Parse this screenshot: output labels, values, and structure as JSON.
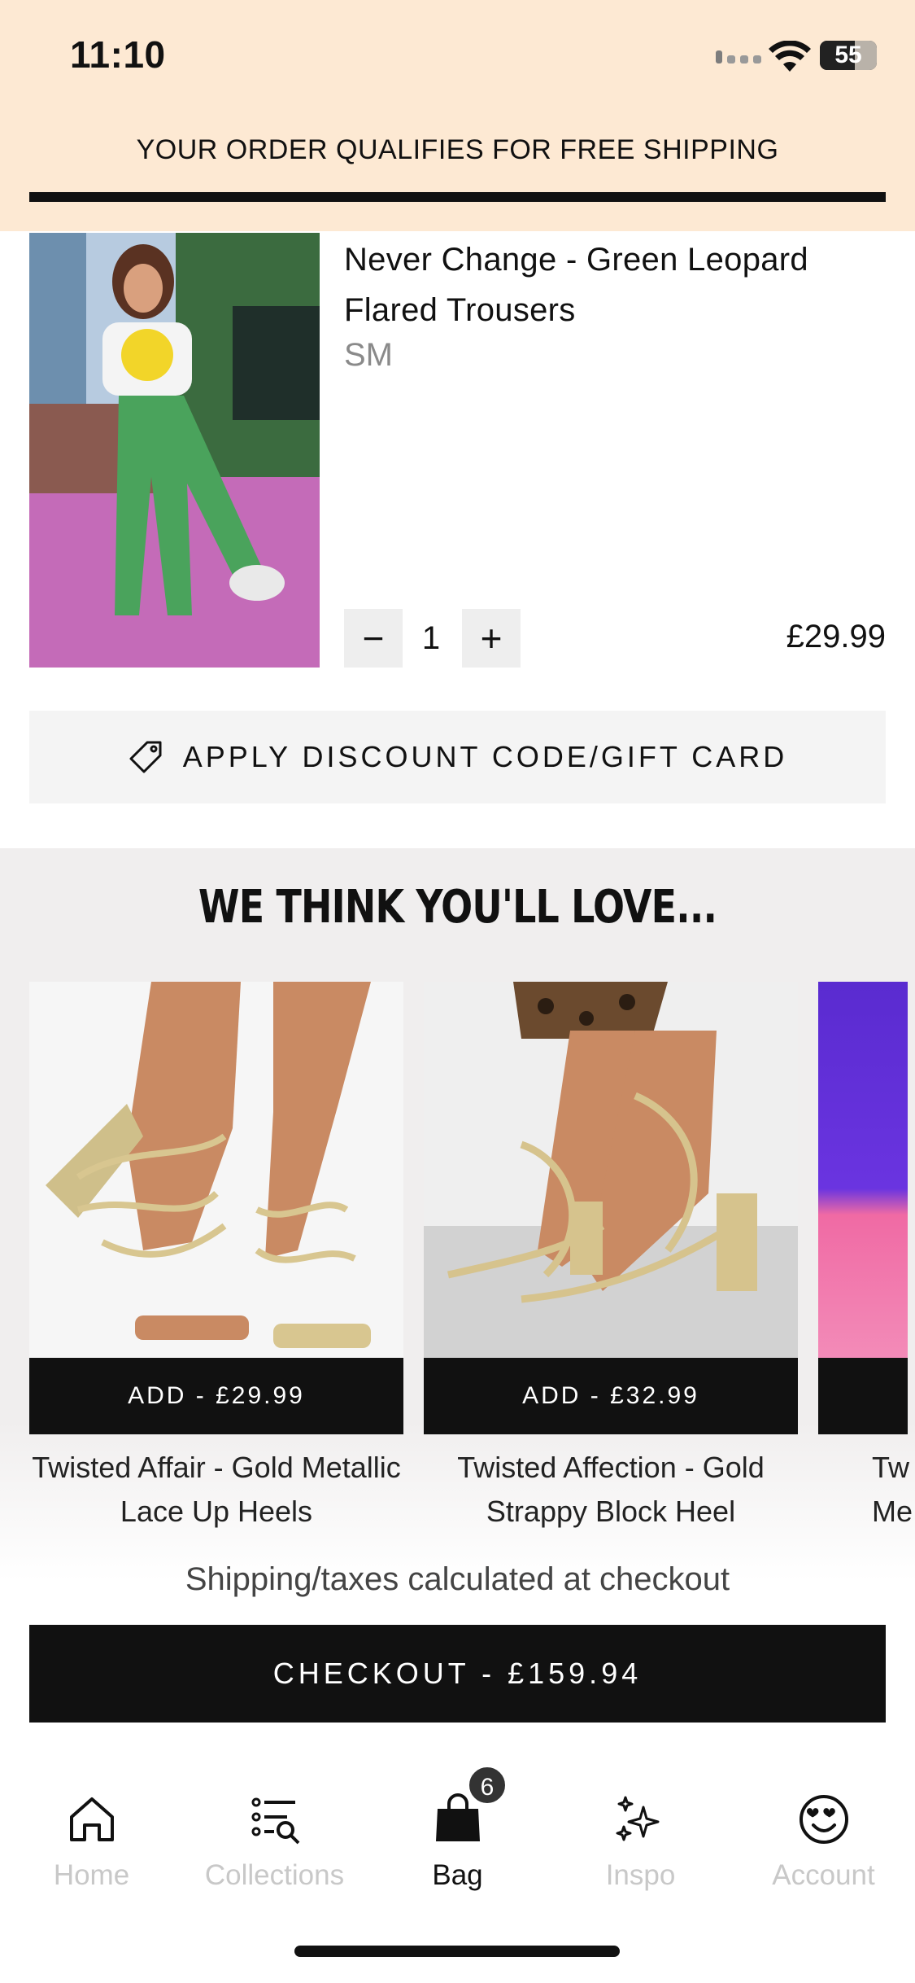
{
  "status_bar": {
    "time": "11:10",
    "battery": "55"
  },
  "banner": {
    "text": "YOUR ORDER QUALIFIES FOR FREE SHIPPING"
  },
  "cart_item": {
    "title": "Never Change - Green Leopard Flared Trousers",
    "size": "SM",
    "quantity": "1",
    "minus": "−",
    "plus": "+",
    "price": "£29.99"
  },
  "discount": {
    "label": "APPLY DISCOUNT CODE/GIFT CARD"
  },
  "recommendations": {
    "title": "WE THINK YOU'LL LOVE...",
    "items": [
      {
        "add_label": "ADD  -  £29.99",
        "name": "Twisted Affair - Gold Metallic Lace Up Heels"
      },
      {
        "add_label": "ADD  -  £32.99",
        "name": "Twisted Affection - Gold Strappy Block Heel"
      },
      {
        "add_label": "",
        "name": "Tw Me"
      }
    ]
  },
  "checkout": {
    "note": "Shipping/taxes calculated at checkout",
    "button": "CHECKOUT - £159.94"
  },
  "tabs": [
    {
      "label": "Home",
      "icon": "home-icon"
    },
    {
      "label": "Collections",
      "icon": "collections-icon"
    },
    {
      "label": "Bag",
      "icon": "bag-icon",
      "badge": "6"
    },
    {
      "label": "Inspo",
      "icon": "sparkles-icon"
    },
    {
      "label": "Account",
      "icon": "smiley-heart-icon"
    }
  ],
  "colors": {
    "banner_bg": "#fde9d3",
    "accent": "#111111",
    "recs_bg": "#f0eeee"
  }
}
